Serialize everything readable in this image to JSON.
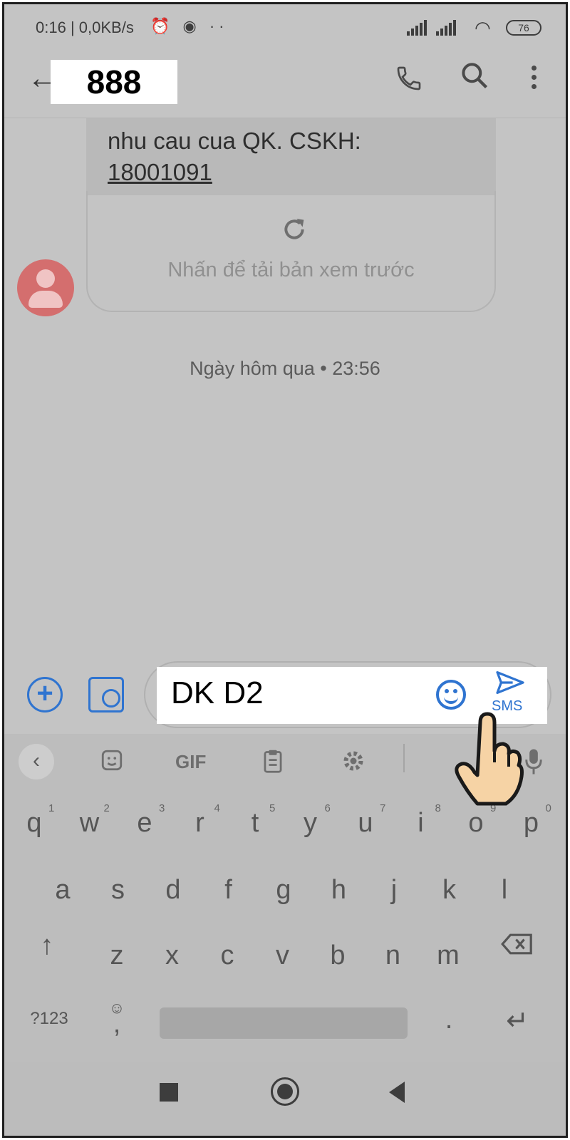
{
  "status_bar": {
    "time": "0:16",
    "network_speed": "0,0KB/s",
    "extra_icons": "⏰ ◉ ··",
    "battery": "76"
  },
  "header": {
    "title": "888"
  },
  "message": {
    "ghost_lines": [
      "...",
      "..."
    ],
    "text_line1": "nhu cau cua QK. CSKH:",
    "link": "18001091",
    "preview_label": "Nhấn để tải bản xem trước"
  },
  "timestamp": "Ngày hôm qua • 23:56",
  "compose": {
    "input_value": "DK D2",
    "send_label": "SMS"
  },
  "keyboard": {
    "toolbar": {
      "gif": "GIF"
    },
    "row1": [
      {
        "k": "q",
        "n": "1"
      },
      {
        "k": "w",
        "n": "2"
      },
      {
        "k": "e",
        "n": "3"
      },
      {
        "k": "r",
        "n": "4"
      },
      {
        "k": "t",
        "n": "5"
      },
      {
        "k": "y",
        "n": "6"
      },
      {
        "k": "u",
        "n": "7"
      },
      {
        "k": "i",
        "n": "8"
      },
      {
        "k": "o",
        "n": "9"
      },
      {
        "k": "p",
        "n": "0"
      }
    ],
    "row2": [
      "a",
      "s",
      "d",
      "f",
      "g",
      "h",
      "j",
      "k",
      "l"
    ],
    "row3": [
      "z",
      "x",
      "c",
      "v",
      "b",
      "n",
      "m"
    ],
    "sym_key": "?123",
    "comma_key": ",",
    "period_key": "."
  },
  "colors": {
    "accent": "#2f74d0",
    "dim_overlay": "#c4c4c4",
    "avatar": "#d46e6e"
  }
}
